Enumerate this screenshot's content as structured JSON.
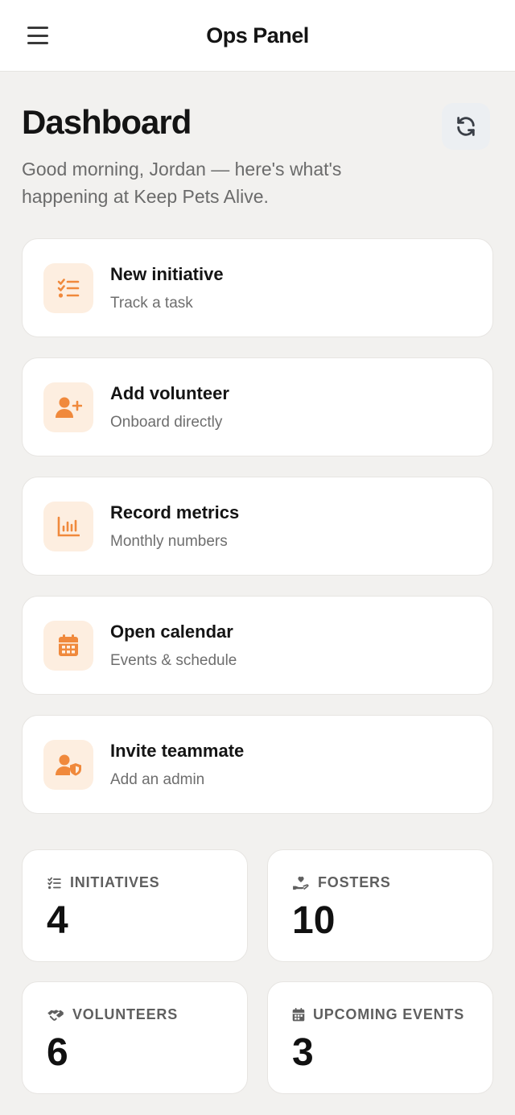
{
  "app": {
    "title": "Ops Panel"
  },
  "dashboard": {
    "title": "Dashboard",
    "greeting": "Good morning, Jordan — here's what's happening at Keep Pets Alive."
  },
  "colors": {
    "accent": "#f0893c",
    "accent_bg": "#fdeee0"
  },
  "actions": [
    {
      "title": "New initiative",
      "subtitle": "Track a task",
      "icon": "checklist-icon"
    },
    {
      "title": "Add volunteer",
      "subtitle": "Onboard directly",
      "icon": "user-plus-icon"
    },
    {
      "title": "Record metrics",
      "subtitle": "Monthly numbers",
      "icon": "bar-chart-icon"
    },
    {
      "title": "Open calendar",
      "subtitle": "Events & schedule",
      "icon": "calendar-icon"
    },
    {
      "title": "Invite teammate",
      "subtitle": "Add an admin",
      "icon": "user-shield-icon"
    }
  ],
  "stats": [
    {
      "label": "INITIATIVES",
      "value": "4",
      "icon": "checklist-icon"
    },
    {
      "label": "FOSTERS",
      "value": "10",
      "icon": "hand-heart-icon"
    },
    {
      "label": "VOLUNTEERS",
      "value": "6",
      "icon": "handshake-icon"
    },
    {
      "label": "UPCOMING EVENTS",
      "value": "3",
      "icon": "calendar-icon"
    }
  ]
}
